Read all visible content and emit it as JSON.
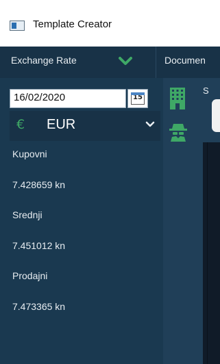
{
  "window": {
    "title": "Template Creator"
  },
  "nav": {
    "exchange_rate": "Exchange Rate",
    "documents": "Documen"
  },
  "date": {
    "value": "16/02/2020",
    "calendar_day": "15"
  },
  "currency": {
    "symbol": "€",
    "code": "EUR"
  },
  "rates": [
    {
      "label": "Kupovni",
      "value": "7.428659 kn"
    },
    {
      "label": "Srednji",
      "value": "7.451012 kn"
    },
    {
      "label": "Prodajni",
      "value": "7.473365 kn"
    }
  ],
  "right_panel": {
    "partial_label": "S"
  },
  "colors": {
    "accent_green": "#3fa866",
    "panel": "#1a3950",
    "navbar": "#183247"
  },
  "icons": [
    "app-icon",
    "chevron-down-icon",
    "calendar-icon",
    "euro-icon",
    "building-icon",
    "spy-icon"
  ]
}
